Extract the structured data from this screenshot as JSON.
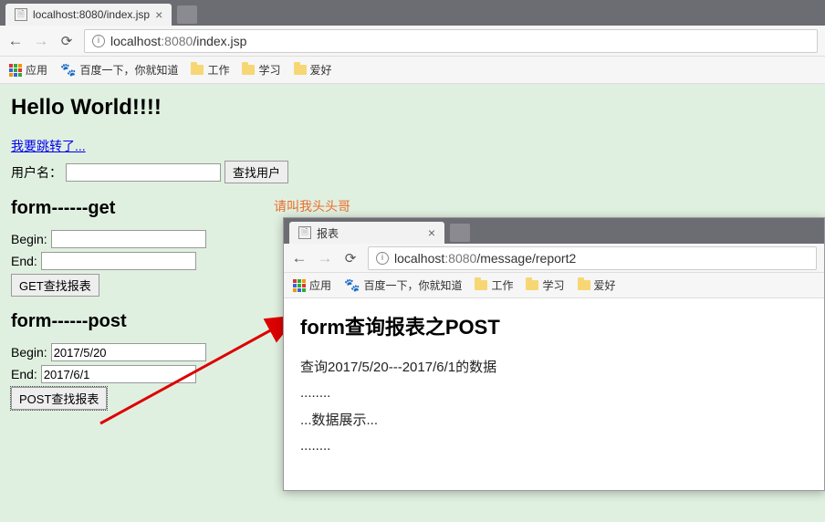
{
  "main_browser": {
    "tab_title": "localhost:8080/index.jsp",
    "url_host": "localhost",
    "url_port": ":8080",
    "url_path": "/index.jsp",
    "bookmarks": {
      "apps": "应用",
      "baidu": "百度一下，你就知道",
      "work": "工作",
      "study": "学习",
      "hobby": "爱好"
    }
  },
  "page": {
    "heading": "Hello World!!!!",
    "jump_link": "我要跳转了...",
    "username_label": "用户名：",
    "search_user_btn": "查找用户",
    "form_get_heading": "form------get",
    "begin_label": "Begin:",
    "end_label": "End:",
    "get_btn": "GET查找报表",
    "form_post_heading": "form------post",
    "post_begin_value": "2017/5/20",
    "post_end_value": "2017/6/1",
    "post_btn": "POST查找报表"
  },
  "annotation": "请叫我头头哥",
  "sub_browser": {
    "tab_title": "报表",
    "url_host": "localhost",
    "url_port": ":8080",
    "url_path": "/message/report2",
    "bookmarks": {
      "apps": "应用",
      "baidu": "百度一下，你就知道",
      "work": "工作",
      "study": "学习",
      "hobby": "爱好"
    }
  },
  "sub_page": {
    "heading": "form查询报表之POST",
    "line1": "查询2017/5/20---2017/6/1的数据",
    "dots1": "........",
    "line2": "...数据展示...",
    "dots2": "........"
  }
}
